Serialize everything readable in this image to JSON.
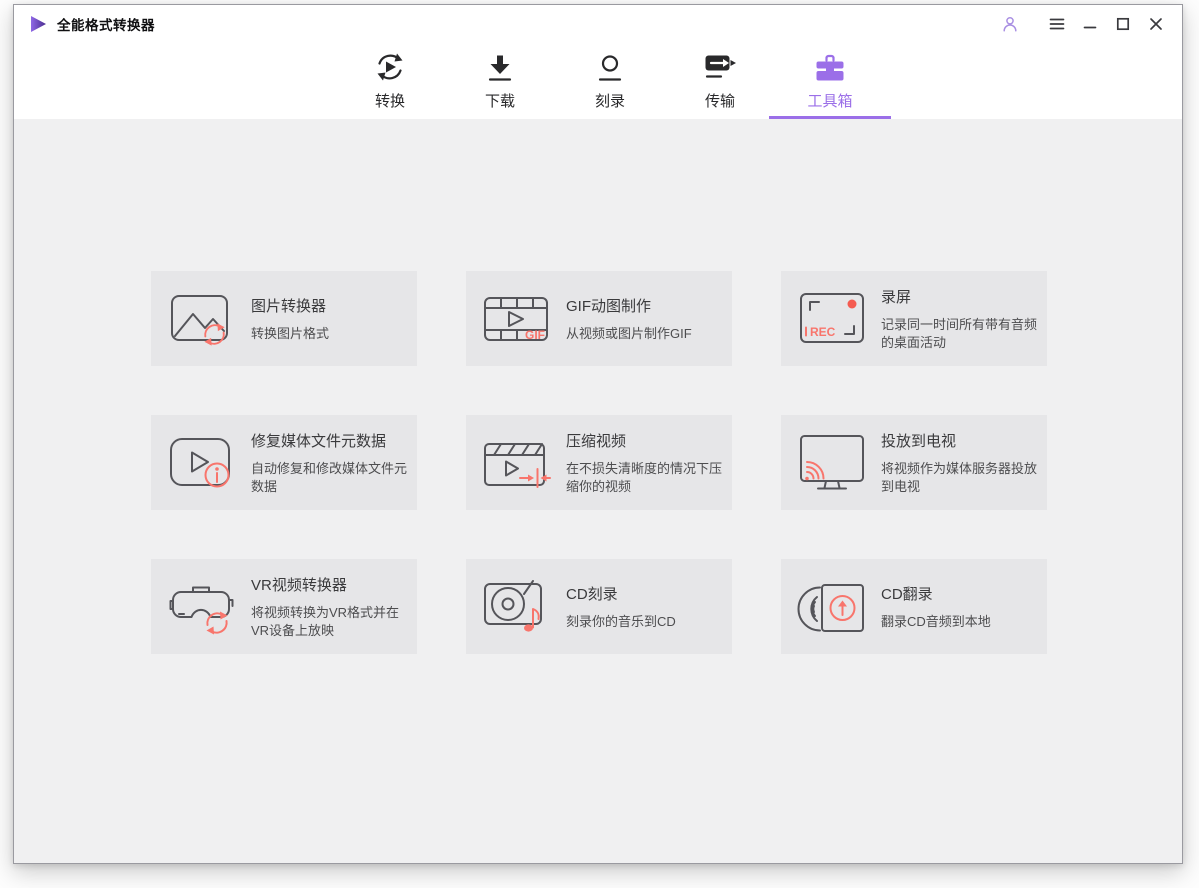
{
  "window": {
    "title": "全能格式转换器"
  },
  "titlebar": {
    "controls": [
      {
        "name": "account",
        "icon": "account-icon"
      },
      {
        "name": "menu",
        "icon": "menu-icon"
      },
      {
        "name": "minimize",
        "icon": "minimize-icon"
      },
      {
        "name": "maximize",
        "icon": "maximize-icon"
      },
      {
        "name": "close",
        "icon": "close-icon"
      }
    ]
  },
  "nav": {
    "tabs": [
      {
        "id": "convert",
        "label": "转换",
        "icon": "convert-icon",
        "active": false
      },
      {
        "id": "download",
        "label": "下载",
        "icon": "download-icon",
        "active": false
      },
      {
        "id": "burn",
        "label": "刻录",
        "icon": "burn-icon",
        "active": false
      },
      {
        "id": "transfer",
        "label": "传输",
        "icon": "transfer-icon",
        "active": false
      },
      {
        "id": "toolbox",
        "label": "工具箱",
        "icon": "toolbox-icon",
        "active": true
      }
    ]
  },
  "toolbox": {
    "cards": [
      {
        "id": "image-converter",
        "title": "图片转换器",
        "desc": "转换图片格式",
        "icon": "image-converter-icon"
      },
      {
        "id": "gif-maker",
        "title": "GIF动图制作",
        "desc": "从视频或图片制作GIF",
        "icon": "gif-maker-icon"
      },
      {
        "id": "screen-record",
        "title": "录屏",
        "desc": "记录同一时间所有带有音频的桌面活动",
        "icon": "screen-record-icon"
      },
      {
        "id": "fix-metadata",
        "title": "修复媒体文件元数据",
        "desc": "自动修复和修改媒体文件元数据",
        "icon": "fix-metadata-icon"
      },
      {
        "id": "compress-video",
        "title": "压缩视频",
        "desc": "在不损失清晰度的情况下压缩你的视频",
        "icon": "compress-video-icon"
      },
      {
        "id": "cast-to-tv",
        "title": "投放到电视",
        "desc": "将视频作为媒体服务器投放到电视",
        "icon": "cast-to-tv-icon"
      },
      {
        "id": "vr-converter",
        "title": "VR视频转换器",
        "desc": "将视频转换为VR格式并在VR设备上放映",
        "icon": "vr-converter-icon"
      },
      {
        "id": "cd-burn",
        "title": "CD刻录",
        "desc": "刻录你的音乐到CD",
        "icon": "cd-burn-icon"
      },
      {
        "id": "cd-rip",
        "title": "CD翻录",
        "desc": "翻录CD音频到本地",
        "icon": "cd-rip-icon"
      }
    ]
  },
  "icon_labels": {
    "gif": "GIF",
    "rec": "REC"
  },
  "colors": {
    "nav_active": "#9b6fe8",
    "accent": "#f8756c",
    "icon_stroke": "#55555a",
    "record_red": "#f45b50"
  }
}
